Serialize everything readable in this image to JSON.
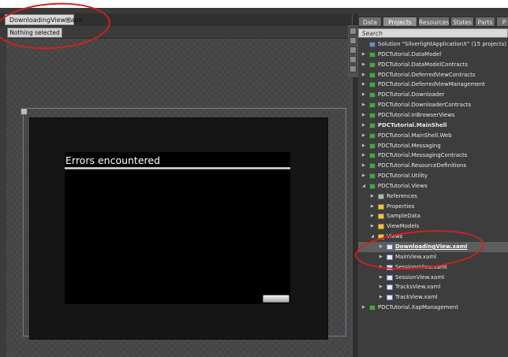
{
  "document": {
    "tab_label": "DownloadingView.xaml",
    "selection_status": "Nothing selected"
  },
  "artboard": {
    "dialog_title": "Errors encountered"
  },
  "panel": {
    "tabs": [
      "Data",
      "Projects",
      "Resources",
      "States",
      "Parts",
      "P"
    ],
    "active_tab": "Projects",
    "search_placeholder": "Search",
    "tree": [
      {
        "label": "Solution \"SilverlightApplicationX\" (15 projects)",
        "icon": "solution-icon",
        "level": 0,
        "expander": "none"
      },
      {
        "label": "PDCTutorial.DataModel",
        "icon": "project-icon",
        "level": 0,
        "expander": "collapsed"
      },
      {
        "label": "PDCTutorial.DataModelContracts",
        "icon": "project-icon",
        "level": 0,
        "expander": "collapsed"
      },
      {
        "label": "PDCTutorial.DeferredViewContracts",
        "icon": "project-icon",
        "level": 0,
        "expander": "collapsed"
      },
      {
        "label": "PDCTutorial.DeferredViewManagement",
        "icon": "project-icon",
        "level": 0,
        "expander": "collapsed"
      },
      {
        "label": "PDCTutorial.Downloader",
        "icon": "project-icon",
        "level": 0,
        "expander": "collapsed"
      },
      {
        "label": "PDCTutorial.DownloaderContracts",
        "icon": "project-icon",
        "level": 0,
        "expander": "collapsed"
      },
      {
        "label": "PDCTutorial.InBrowserViews",
        "icon": "project-icon",
        "level": 0,
        "expander": "collapsed"
      },
      {
        "label": "PDCTutorial.MainShell",
        "icon": "project-icon",
        "level": 0,
        "expander": "collapsed",
        "bold": true
      },
      {
        "label": "PDCTutorial.MainShell.Web",
        "icon": "project-icon",
        "level": 0,
        "expander": "collapsed"
      },
      {
        "label": "PDCTutorial.Messaging",
        "icon": "project-icon",
        "level": 0,
        "expander": "collapsed"
      },
      {
        "label": "PDCTutorial.MessagingContracts",
        "icon": "project-icon",
        "level": 0,
        "expander": "collapsed"
      },
      {
        "label": "PDCTutorial.ResourceDefinitions",
        "icon": "project-icon",
        "level": 0,
        "expander": "collapsed"
      },
      {
        "label": "PDCTutorial.Utility",
        "icon": "project-icon",
        "level": 0,
        "expander": "collapsed"
      },
      {
        "label": "PDCTutorial.Views",
        "icon": "project-icon",
        "level": 0,
        "expander": "expanded"
      },
      {
        "label": "References",
        "icon": "references-icon",
        "level": 1,
        "expander": "collapsed"
      },
      {
        "label": "Properties",
        "icon": "folder-icon",
        "level": 1,
        "expander": "collapsed"
      },
      {
        "label": "SampleData",
        "icon": "folder-icon",
        "level": 1,
        "expander": "collapsed"
      },
      {
        "label": "ViewModels",
        "icon": "folder-icon",
        "level": 1,
        "expander": "collapsed"
      },
      {
        "label": "Views",
        "icon": "folder-icon",
        "level": 1,
        "expander": "expanded"
      },
      {
        "label": "DownloadingView.xaml",
        "icon": "xaml-file-icon",
        "level": 2,
        "expander": "collapsed",
        "selected": true
      },
      {
        "label": "MainView.xaml",
        "icon": "xaml-file-icon",
        "level": 2,
        "expander": "collapsed"
      },
      {
        "label": "SessionsView.xaml",
        "icon": "xaml-file-icon",
        "level": 2,
        "expander": "collapsed"
      },
      {
        "label": "SessionView.xaml",
        "icon": "xaml-file-icon",
        "level": 2,
        "expander": "collapsed"
      },
      {
        "label": "TracksView.xaml",
        "icon": "xaml-file-icon",
        "level": 2,
        "expander": "collapsed"
      },
      {
        "label": "TrackView.xaml",
        "icon": "xaml-file-icon",
        "level": 2,
        "expander": "collapsed"
      },
      {
        "label": "PDCTutorial.XapManagement",
        "icon": "project-icon",
        "level": 0,
        "expander": "collapsed"
      }
    ]
  },
  "colors": {
    "annotation": "#d42020",
    "project_icon": "#4f9f4f",
    "folder_icon": "#e9c35a"
  }
}
